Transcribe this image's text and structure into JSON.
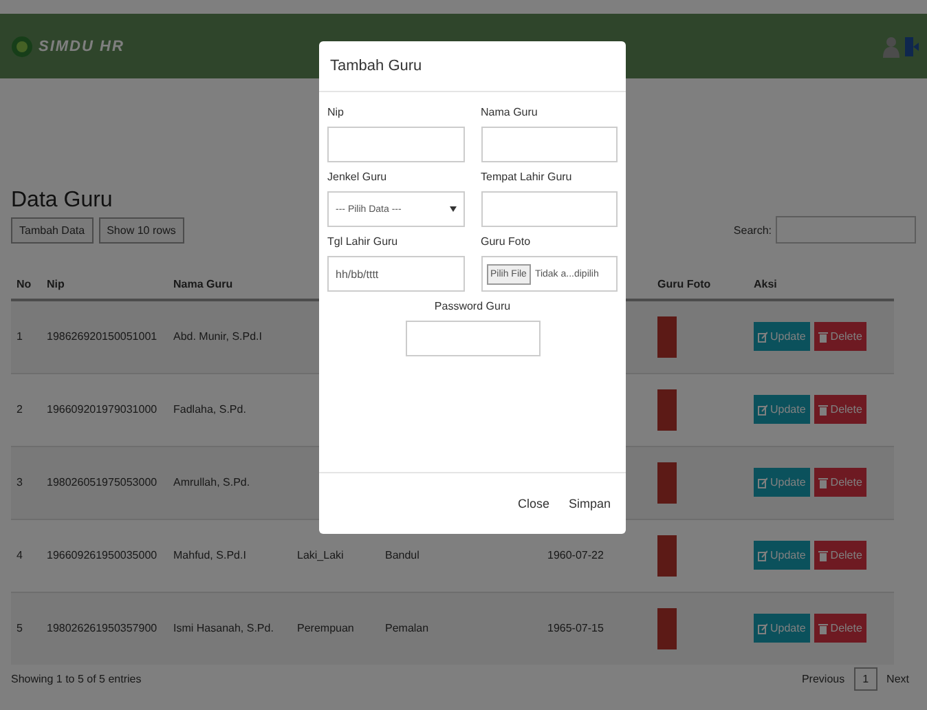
{
  "header": {
    "logo": "SIMDU HR"
  },
  "page": {
    "title": "Data Guru",
    "buttons": [
      "Tambah Data",
      "Show 10 rows"
    ],
    "search_label": "Search:"
  },
  "table": {
    "columns": [
      {
        "label": "No"
      },
      {
        "label": "Nip"
      },
      {
        "label": "Nama Guru"
      },
      {},
      {},
      {},
      {
        "label": "Guru Foto"
      },
      {
        "label": "Aksi"
      }
    ],
    "rows": [
      {
        "no": "1",
        "nip": "198626920150051001",
        "nama": "Abd. Munir, S.Pd.I",
        "actions": [
          "Update",
          "Delete"
        ]
      },
      {
        "no": "2",
        "nip": "196609201979031000",
        "nama": "Fadlaha, S.Pd.",
        "actions": [
          "Update",
          "Delete"
        ]
      },
      {
        "no": "3",
        "nip": "198026051975053000",
        "nama": "Amrullah, S.Pd.",
        "actions": [
          "Update",
          "Delete"
        ]
      },
      {
        "no": "4",
        "nip": "196609261950035000",
        "nama": "Mahfud, S.Pd.I",
        "jenis": "Laki_Laki",
        "tempat": "Bandul",
        "tgl": "1960-07-22",
        "actions": [
          "Update",
          "Delete"
        ]
      },
      {
        "no": "5",
        "nip": "198026261950357900",
        "nama": "Ismi Hasanah, S.Pd.",
        "jenis": "Perempuan",
        "tempat": "Pemalan",
        "tgl": "1965-07-15",
        "actions": [
          "Update",
          "Delete"
        ]
      }
    ],
    "info": "Showing 1 to 5 of 5 entries",
    "pagination": [
      {
        "label": "Previous",
        "selected": false
      },
      {
        "label": "1",
        "selected": true
      },
      {
        "label": "Next",
        "selected": false
      }
    ]
  },
  "modal": {
    "title": "Tambah Guru",
    "fields": [
      {
        "kind": "text",
        "label": "Nip"
      },
      {
        "kind": "text",
        "label": "Nama Guru"
      },
      {
        "kind": "select",
        "label": "Jenkel Guru",
        "value": "--- Pilih Data ---"
      },
      {
        "kind": "text",
        "label": "Tempat Lahir Guru"
      },
      {
        "kind": "date",
        "label": "Tgl Lahir Guru",
        "placeholder": "hh/bb/tttt"
      },
      {
        "kind": "file",
        "label": "Guru Foto",
        "button": "Pilih File",
        "value": "Tidak a...dipilih"
      },
      {
        "kind": "password",
        "label": "Password Guru"
      }
    ],
    "buttons": [
      "Close",
      "Simpan"
    ]
  }
}
